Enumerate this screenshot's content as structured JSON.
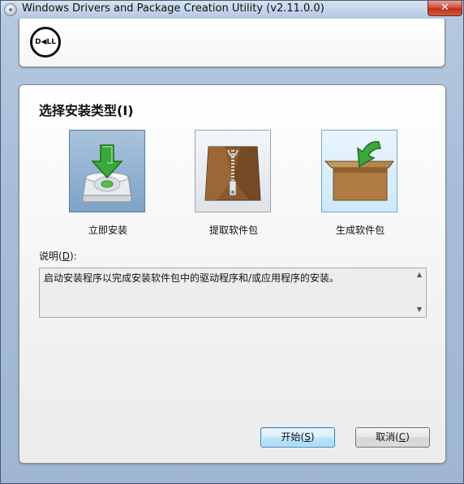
{
  "window": {
    "title": "Windows Drivers and Package Creation Utility (v2.11.0.0)",
    "close_glyph": "✕"
  },
  "header": {
    "logo_text": "D◀LL"
  },
  "main": {
    "section_title": "选择安装类型(I)",
    "options": [
      {
        "label": "立即安装",
        "icon": "install-disk-icon",
        "state": "selected"
      },
      {
        "label": "提取软件包",
        "icon": "zip-box-icon",
        "state": "normal"
      },
      {
        "label": "生成软件包",
        "icon": "create-package-icon",
        "state": "hover"
      }
    ],
    "description_label_prefix": "说明(",
    "description_label_key": "D",
    "description_label_suffix": "):",
    "description_text": "启动安装程序以完成安装软件包中的驱动程序和/或应用程序的安装。",
    "scroll_up_glyph": "▲",
    "scroll_down_glyph": "▼"
  },
  "buttons": {
    "start_prefix": "开始(",
    "start_key": "S",
    "start_suffix": ")",
    "cancel_prefix": "取消(",
    "cancel_key": "C",
    "cancel_suffix": ")"
  },
  "colors": {
    "selected_tile": "#7ea2c7",
    "hover_tile": "#cde8f8",
    "close_button": "#c0301a",
    "arrow_green": "#3aa83a"
  }
}
